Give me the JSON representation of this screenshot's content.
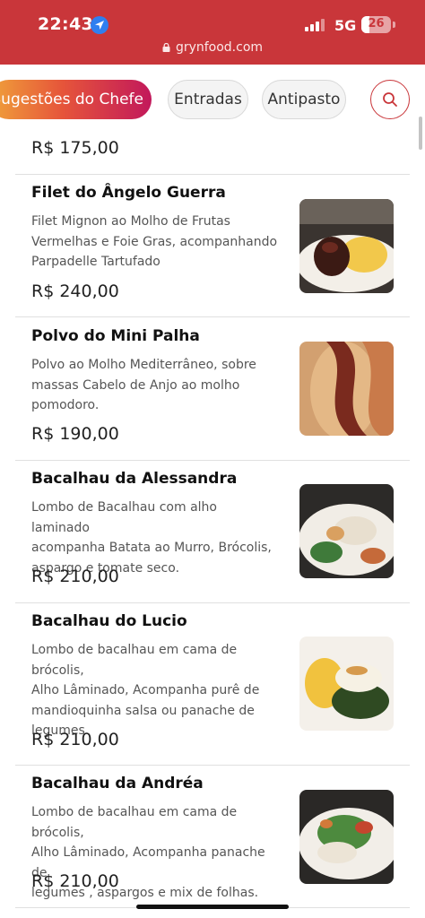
{
  "status_bar": {
    "time": "22:43",
    "network": "5G",
    "battery": "26",
    "battery_level": 0.26
  },
  "browser": {
    "url": "grynfood.com"
  },
  "categories": {
    "active": "Sugestões do Chefe",
    "chips": [
      "Entradas",
      "Antipasto"
    ]
  },
  "menu": {
    "previous_price": "R$ 175,00",
    "items": [
      {
        "name": "Filet do Ângelo Guerra",
        "description_lines": [
          "Filet Mignon ao Molho de Frutas",
          "Vermelhas e Foie Gras, acompanhando",
          "Parpadelle Tartufado"
        ],
        "price": "R$ 240,00",
        "photo": "steak-plate-photo"
      },
      {
        "name": "Polvo do Mini Palha",
        "description_lines": [
          "Polvo ao Molho Mediterrâneo, sobre",
          "massas Cabelo de Anjo ao molho",
          "pomodoro."
        ],
        "price": "R$ 190,00",
        "photo": "octopus-pasta-photo"
      },
      {
        "name": "Bacalhau da Alessandra",
        "description_lines": [
          "Lombo de Bacalhau com alho laminado",
          "acompanha Batata ao Murro, Brócolis,",
          "aspargo e tomate seco."
        ],
        "price": "R$ 210,00",
        "photo": "cod-potatoes-photo"
      },
      {
        "name": "Bacalhau do Lucio",
        "description_lines": [
          "Lombo de bacalhau em cama de brócolis,",
          "Alho Lâminado, Acompanha purê de",
          "mandioquinha salsa ou panache de",
          "legumes"
        ],
        "price": "R$ 210,00",
        "photo": "cod-puree-photo"
      },
      {
        "name": "Bacalhau da Andréa",
        "description_lines": [
          "Lombo de bacalhau em cama de brócolis,",
          "Alho Lâminado, Acompanha panache de",
          "legumes , aspargos e mix de folhas."
        ],
        "price": "R$ 210,00",
        "photo": "cod-vegetables-photo"
      }
    ]
  }
}
